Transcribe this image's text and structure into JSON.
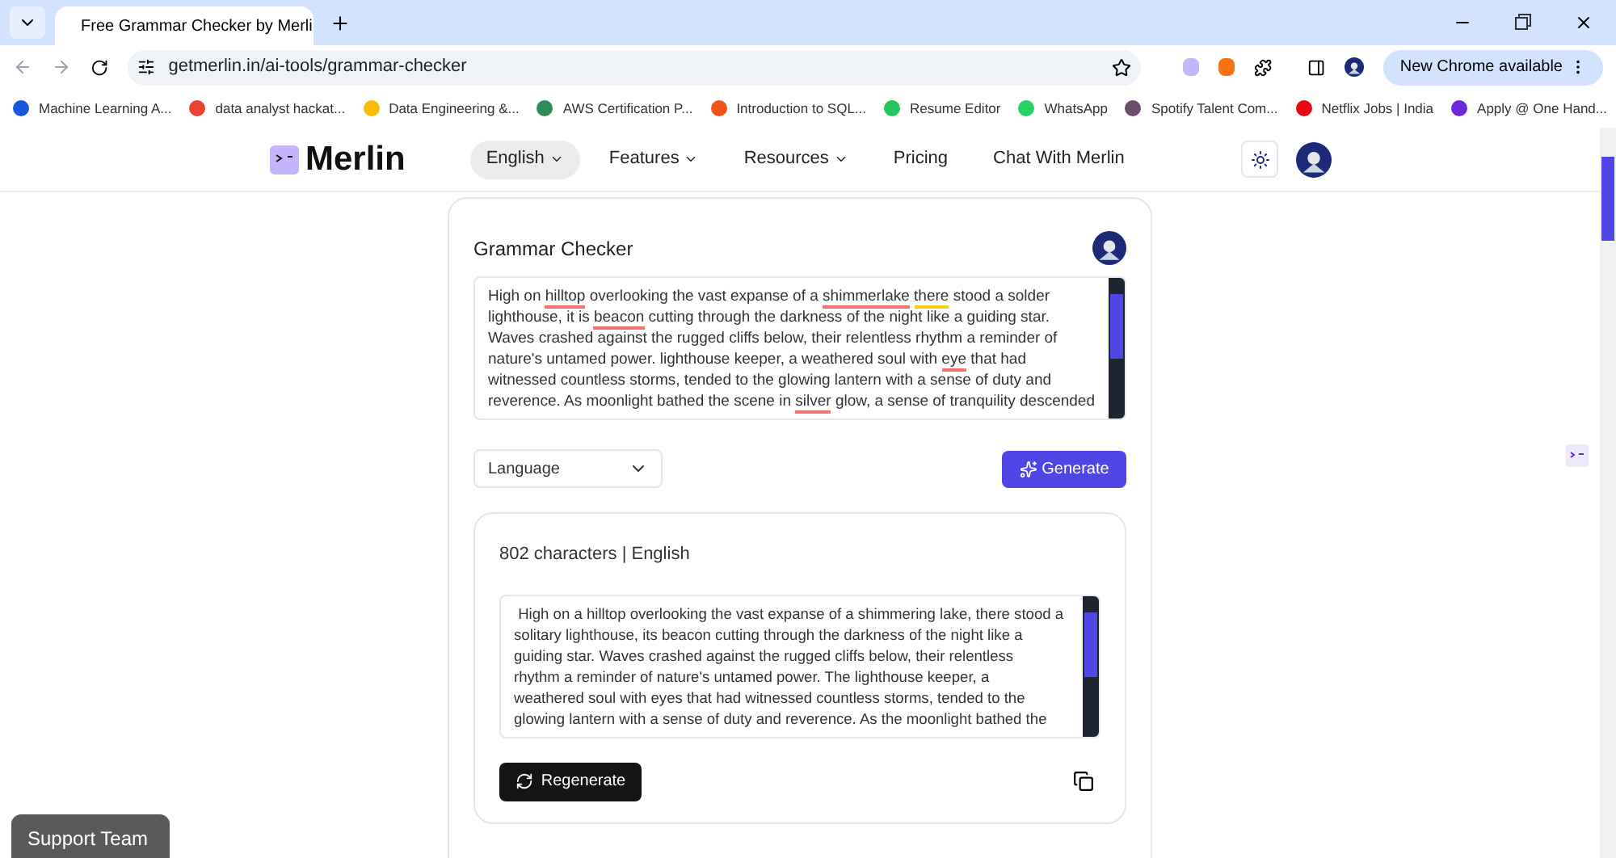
{
  "browser": {
    "tabs": [
      {
        "title": "Free Grammar Checker by Merli",
        "selected": true
      }
    ],
    "url": "getmerlin.in/ai-tools/grammar-checker",
    "update_button": "New Chrome available",
    "bookmarks": [
      {
        "label": "Machine Learning A...",
        "color": "#1a56db"
      },
      {
        "label": "data analyst hackat...",
        "color": "#ea4335"
      },
      {
        "label": "Data Engineering &...",
        "color": "#fbbc04"
      },
      {
        "label": "AWS Certification P...",
        "color": "#2e8b57"
      },
      {
        "label": "Introduction to SQL...",
        "color": "#f4511e"
      },
      {
        "label": "Resume Editor",
        "color": "#22c55e"
      },
      {
        "label": "WhatsApp",
        "color": "#25d366"
      },
      {
        "label": "Spotify Talent Com...",
        "color": "#6b4e6b"
      },
      {
        "label": "Netflix Jobs | India",
        "color": "#e50914"
      },
      {
        "label": "Apply @ One Hand...",
        "color": "#6d28d9"
      }
    ]
  },
  "site": {
    "logo": "Merlin",
    "nav": [
      {
        "label": "English",
        "dropdown": true,
        "selected": true
      },
      {
        "label": "Features",
        "dropdown": true,
        "selected": false
      },
      {
        "label": "Resources",
        "dropdown": true,
        "selected": false
      },
      {
        "label": "Pricing",
        "dropdown": false,
        "selected": false
      },
      {
        "label": "Chat With Merlin",
        "dropdown": false,
        "selected": false
      }
    ]
  },
  "checker": {
    "title": "Grammar Checker",
    "input_lines": [
      [
        {
          "text": "High on ",
          "kind": "plain"
        },
        {
          "text": "hilltop",
          "kind": "spelling"
        },
        {
          "text": " overlooking the vast expanse of a ",
          "kind": "plain"
        },
        {
          "text": "shimmerlake ",
          "kind": "spelling"
        },
        {
          "text": "there",
          "kind": "grammar"
        },
        {
          "text": " stood a solder",
          "kind": "plain"
        }
      ],
      [
        {
          "text": "lighthouse, it is ",
          "kind": "plain"
        },
        {
          "text": "beacon",
          "kind": "spelling"
        },
        {
          "text": " cutting through the darkness of the night like a guiding star.",
          "kind": "plain"
        }
      ],
      [
        {
          "text": "Waves crashed against the rugged cliffs below, their relentless rhythm a reminder of",
          "kind": "plain"
        }
      ],
      [
        {
          "text": "nature's untamed power. lighthouse keeper, a weathered soul with ",
          "kind": "plain"
        },
        {
          "text": "eye",
          "kind": "spelling"
        },
        {
          "text": " that had",
          "kind": "plain"
        }
      ],
      [
        {
          "text": "witnessed countless storms, tended to the glowing lantern with a sense of duty and",
          "kind": "plain"
        }
      ],
      [
        {
          "text": "reverence. As moonlight bathed the scene in ",
          "kind": "plain"
        },
        {
          "text": "silver",
          "kind": "spelling"
        },
        {
          "text": " glow, a sense of tranquility descended",
          "kind": "plain"
        }
      ]
    ],
    "language_placeholder": "Language",
    "generate_button": "Generate",
    "result_meta": "802 characters | English",
    "output_lines": [
      " High on a hilltop overlooking the vast expanse of a shimmering lake, there stood a",
      "solitary lighthouse, its beacon cutting through the darkness of the night like a",
      "guiding star. Waves crashed against the rugged cliffs below, their relentless",
      "rhythm a reminder of nature's untamed power. The lighthouse keeper, a",
      "weathered soul with eyes that had witnessed countless storms, tended to the",
      "glowing lantern with a sense of duty and reverence. As the moonlight bathed the"
    ],
    "regenerate_button": "Regenerate"
  },
  "support_button": "Support Team"
}
